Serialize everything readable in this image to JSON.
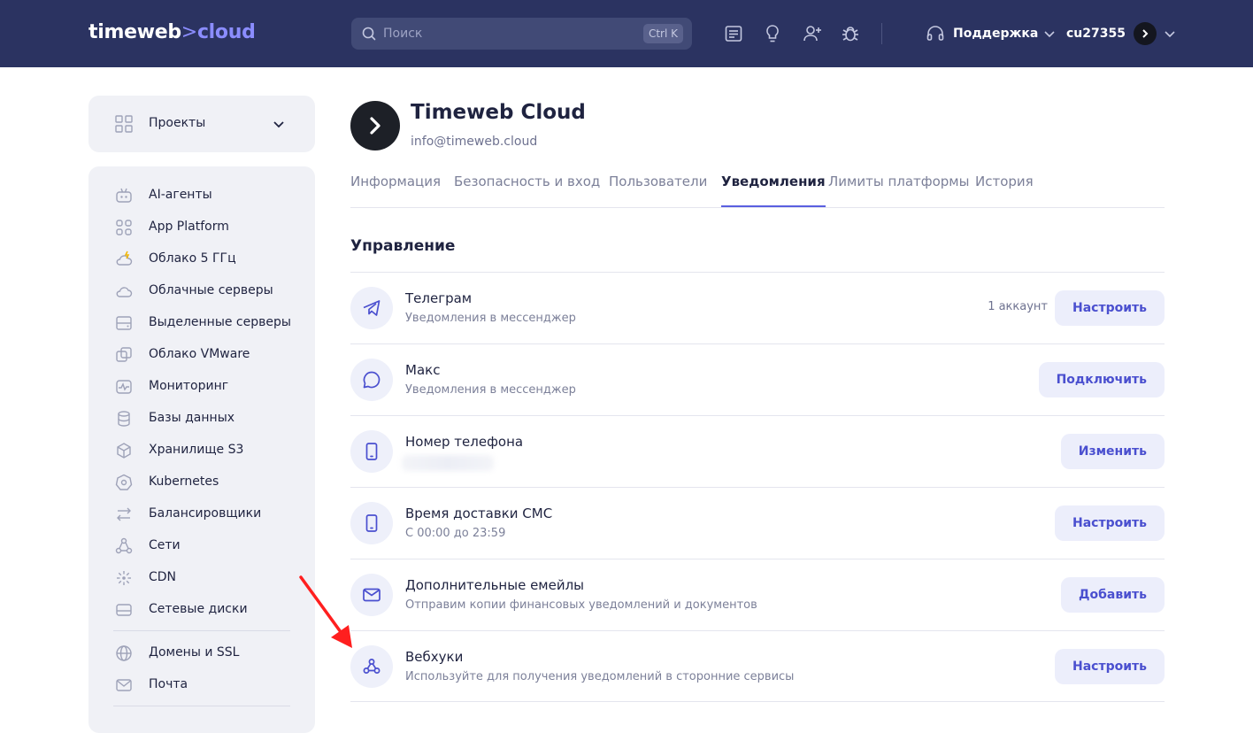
{
  "header": {
    "logo_main": "timeweb",
    "logo_sep": ">",
    "logo_cloud": "cloud",
    "search_placeholder": "Поиск",
    "search_shortcut": "Ctrl K",
    "support_label": "Поддержка",
    "account_name": "cu27355",
    "icons": [
      "docs-icon",
      "lightbulb-icon",
      "add-user-icon",
      "bug-icon",
      "headset-icon"
    ]
  },
  "sidebar": {
    "projects_label": "Проекты",
    "items": [
      {
        "label": "AI-агенты",
        "icon": "robot-icon"
      },
      {
        "label": "App Platform",
        "icon": "apps-grid-icon"
      },
      {
        "label": "Облако 5 ГГц",
        "icon": "lightning-cloud-icon"
      },
      {
        "label": "Облачные серверы",
        "icon": "cloud-icon"
      },
      {
        "label": "Выделенные серверы",
        "icon": "server-icon"
      },
      {
        "label": "Облако VMware",
        "icon": "vmware-icon"
      },
      {
        "label": "Мониторинг",
        "icon": "monitoring-icon"
      },
      {
        "label": "Базы данных",
        "icon": "database-icon"
      },
      {
        "label": "Хранилище S3",
        "icon": "cube-icon"
      },
      {
        "label": "Kubernetes",
        "icon": "kubernetes-icon"
      },
      {
        "label": "Балансировщики",
        "icon": "arrows-icon"
      },
      {
        "label": "Сети",
        "icon": "network-icon"
      },
      {
        "label": "CDN",
        "icon": "cdn-icon"
      },
      {
        "label": "Сетевые диски",
        "icon": "disk-icon"
      },
      {
        "label": "Домены и SSL",
        "icon": "globe-icon"
      },
      {
        "label": "Почта",
        "icon": "mail-icon"
      }
    ]
  },
  "org": {
    "title": "Timeweb Cloud",
    "email": "info@timeweb.cloud"
  },
  "tabs": [
    {
      "label": "Информация",
      "active": false
    },
    {
      "label": "Безопасность и вход",
      "active": false
    },
    {
      "label": "Пользователи",
      "active": false
    },
    {
      "label": "Уведомления",
      "active": true
    },
    {
      "label": "Лимиты платформы",
      "active": false
    },
    {
      "label": "История",
      "active": false
    }
  ],
  "section_title": "Управление",
  "rows": [
    {
      "title": "Телеграм",
      "subtitle": "Уведомления в мессенджер",
      "meta": "1 аккаунт",
      "button": "Настроить",
      "icon": "telegram-icon"
    },
    {
      "title": "Макс",
      "subtitle": "Уведомления в мессенджер",
      "meta": "",
      "button": "Подключить",
      "icon": "chat-bubble-icon"
    },
    {
      "title": "Номер телефона",
      "subtitle": "",
      "meta": "",
      "button": "Изменить",
      "icon": "phone-icon"
    },
    {
      "title": "Время доставки СМС",
      "subtitle": "С 00:00 до 23:59",
      "meta": "",
      "button": "Настроить",
      "icon": "phone-icon"
    },
    {
      "title": "Дополнительные емейлы",
      "subtitle": "Отправим копии финансовых уведомлений и документов",
      "meta": "",
      "button": "Добавить",
      "icon": "mail-icon"
    },
    {
      "title": "Вебхуки",
      "subtitle": "Используйте для получения уведомлений в сторонние сервисы",
      "meta": "",
      "button": "Настроить",
      "icon": "webhook-icon"
    }
  ],
  "colors": {
    "topbar": "#2b3361",
    "accent": "#5a5fe0",
    "button_bg": "#eceefb",
    "annotation_arrow": "#ff1f1f"
  }
}
